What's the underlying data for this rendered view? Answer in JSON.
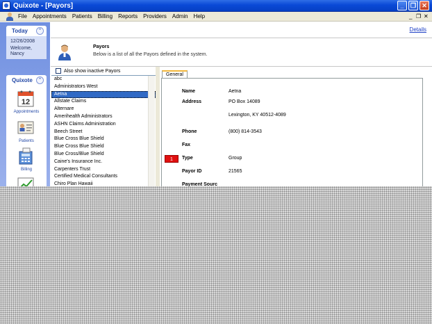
{
  "window": {
    "title": "Quixote - [Payors]"
  },
  "menu": {
    "items": [
      "File",
      "Appointments",
      "Patients",
      "Billing",
      "Reports",
      "Providers",
      "Admin",
      "Help"
    ]
  },
  "today": {
    "header": "Today",
    "date": "12/26/2008",
    "welcome": "Welcome,",
    "user": "Nancy"
  },
  "quixote": {
    "header": "Quixote",
    "nav": {
      "appointments": "Appointments",
      "patients": "Patients",
      "billing": "Billing"
    },
    "calendar_day": "12"
  },
  "header": {
    "details_link": "Details",
    "title": "Payors",
    "subtitle": "Below is a list of all the Payors defined in the system."
  },
  "list": {
    "inactive_label": "Also show inactive Payors",
    "items": [
      "abc",
      "Administrators West",
      "Aetna",
      "Allstate Claims",
      "Alternare",
      "Amerihealth Administrators",
      "ASHN Claims Administration",
      "Beech Street",
      "Blue Cross Blue Shield",
      "Blue Cross Blue Shield",
      "Blue Cross/Blue Shield",
      "Caine's Insurance Inc.",
      "Carpenters Trust",
      "Certified Medical Consultants",
      "Chiro Plan Hawaii"
    ],
    "selected_index": 2
  },
  "details": {
    "tab": "General",
    "name_label": "Name",
    "name_value": "Aetna",
    "address_label": "Address",
    "address_line1": "PO Box 14089",
    "address_line2": "Lexington, KY 40512-4089",
    "phone_label": "Phone",
    "phone_value": "(800) 814-3543",
    "fax_label": "Fax",
    "type_label": "Type",
    "type_value": "Group",
    "type_flag": "1",
    "payor_id_label": "Payor ID",
    "payor_id_value": "21565",
    "payment_source_label": "Payment Sourc"
  },
  "colors": {
    "titlebar": "#0a49d6",
    "selection": "#316ac5",
    "flag": "#e01010",
    "link": "#1d3fc4"
  }
}
